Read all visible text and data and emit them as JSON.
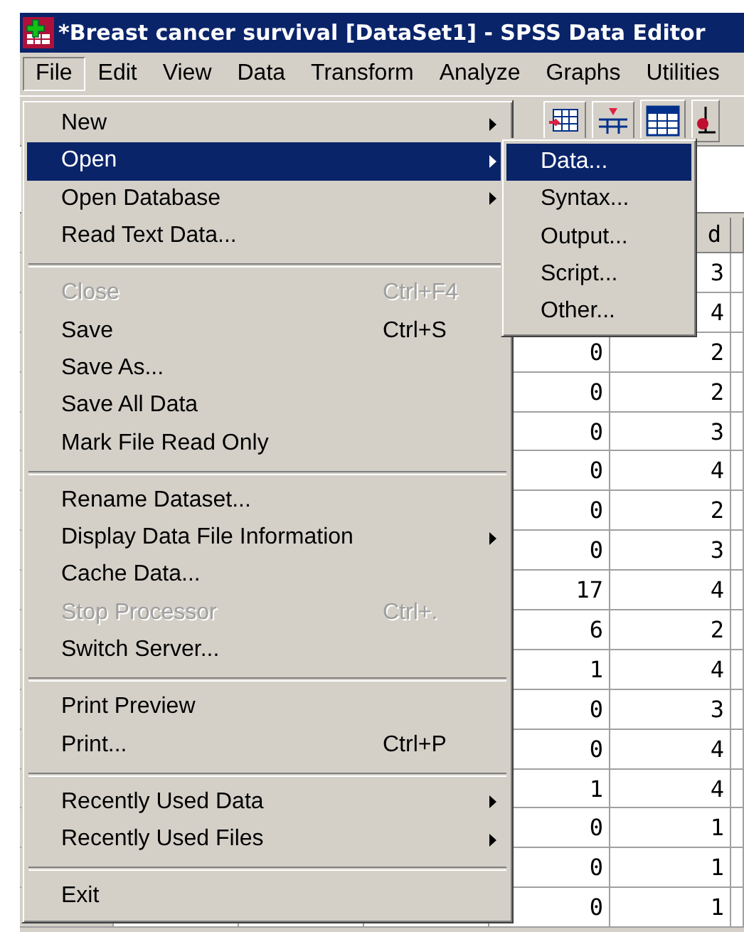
{
  "window": {
    "title": "*Breast cancer survival [DataSet1] - SPSS Data Editor"
  },
  "menu_bar": [
    {
      "label": "File",
      "selected": true
    },
    {
      "label": "Edit",
      "selected": false
    },
    {
      "label": "View",
      "selected": false
    },
    {
      "label": "Data",
      "selected": false
    },
    {
      "label": "Transform",
      "selected": false
    },
    {
      "label": "Analyze",
      "selected": false
    },
    {
      "label": "Graphs",
      "selected": false
    },
    {
      "label": "Utilities",
      "selected": false
    }
  ],
  "file_menu": {
    "sections": [
      [
        {
          "label": "New",
          "submenu": true,
          "selected": false,
          "disabled": false
        },
        {
          "label": "Open",
          "submenu": true,
          "selected": true,
          "disabled": false
        },
        {
          "label": "Open Database",
          "submenu": true,
          "selected": false,
          "disabled": false
        },
        {
          "label": "Read Text Data...",
          "submenu": false,
          "selected": false,
          "disabled": false
        }
      ],
      [
        {
          "label": "Close",
          "shortcut": "Ctrl+F4",
          "submenu": false,
          "selected": false,
          "disabled": true
        },
        {
          "label": "Save",
          "shortcut": "Ctrl+S",
          "submenu": false,
          "selected": false,
          "disabled": false
        },
        {
          "label": "Save As...",
          "submenu": false,
          "selected": false,
          "disabled": false
        },
        {
          "label": "Save All Data",
          "submenu": false,
          "selected": false,
          "disabled": false
        },
        {
          "label": "Mark File Read Only",
          "submenu": false,
          "selected": false,
          "disabled": false
        }
      ],
      [
        {
          "label": "Rename Dataset...",
          "submenu": false,
          "selected": false,
          "disabled": false
        },
        {
          "label": "Display Data File Information",
          "submenu": true,
          "selected": false,
          "disabled": false
        },
        {
          "label": "Cache Data...",
          "submenu": false,
          "selected": false,
          "disabled": false
        },
        {
          "label": "Stop Processor",
          "shortcut": "Ctrl+.",
          "submenu": false,
          "selected": false,
          "disabled": true
        },
        {
          "label": "Switch Server...",
          "submenu": false,
          "selected": false,
          "disabled": false
        }
      ],
      [
        {
          "label": "Print Preview",
          "submenu": false,
          "selected": false,
          "disabled": false
        },
        {
          "label": "Print...",
          "shortcut": "Ctrl+P",
          "submenu": false,
          "selected": false,
          "disabled": false
        }
      ],
      [
        {
          "label": "Recently Used Data",
          "submenu": true,
          "selected": false,
          "disabled": false
        },
        {
          "label": "Recently Used Files",
          "submenu": true,
          "selected": false,
          "disabled": false
        }
      ],
      [
        {
          "label": "Exit",
          "submenu": false,
          "selected": false,
          "disabled": false
        }
      ]
    ]
  },
  "open_submenu": [
    {
      "label": "Data...",
      "selected": true
    },
    {
      "label": "Syntax...",
      "selected": false
    },
    {
      "label": "Output...",
      "selected": false
    },
    {
      "label": "Script...",
      "selected": false
    },
    {
      "label": "Other...",
      "selected": false
    }
  ],
  "data_grid": {
    "column_2_header": "d",
    "rows": [
      {
        "column_2": "3"
      },
      {
        "column_2": "4"
      },
      {
        "column_1": "0",
        "column_2": "2"
      },
      {
        "column_1": "0",
        "column_2": "2"
      },
      {
        "column_1": "0",
        "column_2": "3"
      },
      {
        "column_1": "0",
        "column_2": "4"
      },
      {
        "column_1": "0",
        "column_2": "2"
      },
      {
        "column_1": "0",
        "column_2": "3"
      },
      {
        "column_1": "17",
        "column_2": "4"
      },
      {
        "column_1": "6",
        "column_2": "2"
      },
      {
        "column_1": "1",
        "column_2": "4"
      },
      {
        "column_1": "0",
        "column_2": "3"
      },
      {
        "column_1": "0",
        "column_2": "4"
      },
      {
        "column_1": "1",
        "column_2": "4"
      },
      {
        "column_1": "0",
        "column_2": "1"
      },
      {
        "column_1": "0",
        "column_2": "1"
      },
      {
        "column_1": "0",
        "column_2": "1"
      }
    ]
  }
}
